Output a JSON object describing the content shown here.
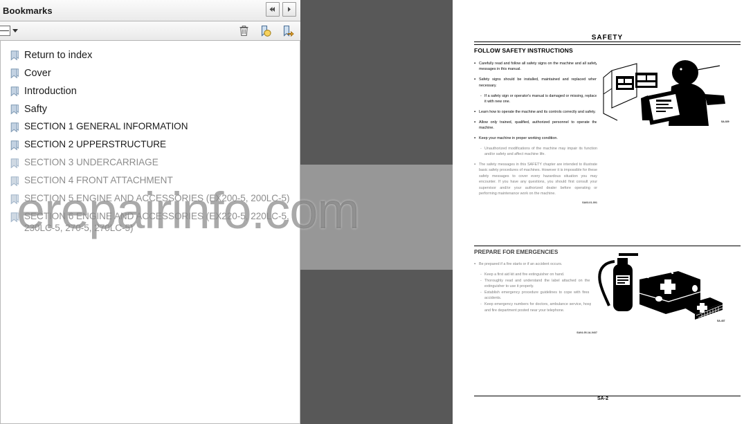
{
  "panel": {
    "title": "Bookmarks",
    "nav": {
      "prev_label": "◂◂",
      "next_label": "▸"
    },
    "toolbar": {
      "options_label": "Options",
      "delete_label": "Delete",
      "new_bookmark_label": "New Bookmark",
      "expand_label": "Expand Current Bookmark"
    },
    "bookmarks": [
      {
        "label": "Return to index",
        "dim": false,
        "wrap": false,
        "section": false
      },
      {
        "label": "Cover",
        "dim": false,
        "wrap": false,
        "section": false
      },
      {
        "label": "Introduction",
        "dim": false,
        "wrap": false,
        "section": false
      },
      {
        "label": "Safty",
        "dim": false,
        "wrap": false,
        "section": false
      },
      {
        "label": "SECTION 1 GENERAL INFORMATION",
        "dim": false,
        "wrap": false,
        "section": true
      },
      {
        "label": "SECTION 2 UPPERSTRUCTURE",
        "dim": false,
        "wrap": false,
        "section": true
      },
      {
        "label": "SECTION 3 UNDERCARRIAGE",
        "dim": true,
        "wrap": false,
        "section": true
      },
      {
        "label": "SECTION 4 FRONT ATTACHMENT",
        "dim": true,
        "wrap": false,
        "section": true
      },
      {
        "label": "SECTION 5 ENGINE AND ACCESSORIES (EX200-5, 200LC-5)",
        "dim": true,
        "wrap": false,
        "section": true
      },
      {
        "label": "SECTION 6 ENGINE AND ACCESSORIES (EX220-5, 220LC-5, 230LC-5, 270-5, 270LC-5)",
        "dim": true,
        "wrap": true,
        "section": true
      }
    ]
  },
  "watermark": {
    "text": "erepairinfo.com"
  },
  "document": {
    "running_head": "SAFETY",
    "page_number": "SA-2",
    "section1": {
      "heading": "FOLLOW SAFETY INSTRUCTIONS",
      "bullets": [
        "Carefully read and follow all safety signs on the machine and all safety messages in this manual.",
        "Safety signs should be installed, maintained and replaced when necessary."
      ],
      "sub1": "If a safety sign or operator's manual is damaged or missing, replace it with new one.",
      "bullets2": [
        "Learn how to operate the machine and its controls correctly and safety.",
        "Allow only trained, qualified, authorized personnel to operate the machine.",
        "Keep your machine in proper working condition."
      ],
      "sub2": "Unauthorized modifications of the machine may impair its function and/or safety and affect machine life.",
      "bullet3": "The safety messages in this SAFETY chapter are intended to illustrate basic safety procedures of machines. However it is impossible for these safety messages to cover every hazardous situation you may encounter. If you have any questions, you should first consult your supervisor and/or your authorized dealer before operating or performing maintenance work on the machine.",
      "footnote": "SA03-01-001",
      "figure_code": "SA-029",
      "figure_name": "operator-reading-manual-illustration"
    },
    "section2": {
      "heading": "PREPARE FOR EMERGENCIES",
      "bullet": "Be prepared if a fire starts or if an accident occurs.",
      "subs": [
        "Keep a first aid kit and fire extinguisher on hand.",
        "Thoroughly read and understand the label attached on the fire extinguisher to use it properly.",
        "Establish emergency procedure guidelines to cope with fires and accidents.",
        "Keep emergency numbers for doctors, ambulance service, hospital, and fire department posted near your telephone."
      ],
      "footnote": "SA04-05-1A-0437",
      "figure_code": "SA-437",
      "figure_name": "fire-extinguisher-first-aid-kit-illustration"
    }
  },
  "colors": {
    "viewer_background": "#585858",
    "panel_background": "#f2f2f2",
    "page_background": "#ffffff",
    "bookmark_icon": "#8fa8c0",
    "dim_text": "#8d8d8d"
  }
}
